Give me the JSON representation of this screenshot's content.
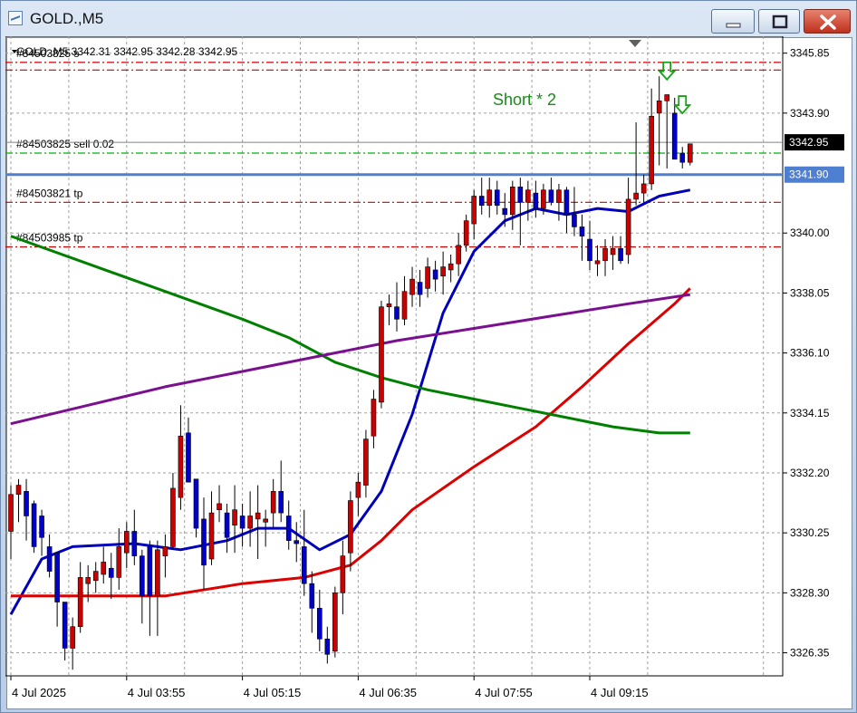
{
  "window": {
    "title": "GOLD.,M5",
    "minimize_icon": "minimize-icon",
    "maximize_icon": "maximize-icon",
    "close_icon": "close-icon"
  },
  "header_info": {
    "ohlc_text": "GOLD.,M5  3342.31 3342.95 3342.28 3342.95",
    "overlay_text": "#84503825 s"
  },
  "annotation": {
    "text": "Short * 2",
    "color": "#1a8a1a"
  },
  "price_axis": {
    "labels": [
      "3345.85",
      "3343.90",
      "3342.95",
      "3341.90",
      "3340.00",
      "3338.05",
      "3336.10",
      "3334.15",
      "3332.20",
      "3330.25",
      "3328.30",
      "3326.35"
    ]
  },
  "time_axis": {
    "labels": [
      "4 Jul 2025",
      "4 Jul 03:55",
      "4 Jul 05:15",
      "4 Jul 06:35",
      "4 Jul 07:55",
      "4 Jul 09:15"
    ]
  },
  "order_lines": [
    {
      "label": "#84503825 sell 0.02",
      "price": 3342.6,
      "color": "#00b000",
      "style": "dashdot"
    },
    {
      "label": "#84503821 tp",
      "price": 3341.0,
      "color": "#cc0000",
      "style": "dashdot"
    },
    {
      "label": "#84503985 tp",
      "price": 3339.55,
      "color": "#cc0000",
      "style": "dashdot"
    },
    {
      "label": "",
      "price": 3345.55,
      "color": "#cc0000",
      "style": "dashdot"
    },
    {
      "label": "",
      "price": 3345.3,
      "color": "#cc0000",
      "style": "dashdot"
    }
  ],
  "bid_line": {
    "price": 3342.95,
    "label": "3342.95"
  },
  "ask_line": {
    "price": 3341.9,
    "label": "3341.90",
    "color": "#4f7fd0"
  },
  "colors": {
    "bull": "#0000cc",
    "bear": "#cc0000",
    "ma_fast": "#0000bb",
    "ma_mid": "#dd0000",
    "ma_slow": "#008000",
    "ma_long": "#7a1090"
  },
  "chart_data": {
    "type": "candlestick",
    "symbol": "GOLD.",
    "timeframe": "M5",
    "ylim": [
      3325.6,
      3346.4
    ],
    "x_tick_labels": [
      "4 Jul 2025",
      "4 Jul 03:55",
      "4 Jul 05:15",
      "4 Jul 06:35",
      "4 Jul 07:55",
      "4 Jul 09:15"
    ],
    "candles": [
      [
        3330.3,
        3331.8,
        3329.4,
        3331.5
      ],
      [
        3331.5,
        3332.0,
        3330.6,
        3331.8
      ],
      [
        3331.6,
        3332.0,
        3330.0,
        3330.8
      ],
      [
        3331.2,
        3331.3,
        3329.6,
        3329.8
      ],
      [
        3330.8,
        3331.0,
        3329.5,
        3330.1
      ],
      [
        3329.8,
        3330.2,
        3328.8,
        3329.0
      ],
      [
        3329.6,
        3329.6,
        3327.2,
        3328.0
      ],
      [
        3328.0,
        3328.0,
        3326.1,
        3326.5
      ],
      [
        3326.5,
        3327.5,
        3325.8,
        3327.2
      ],
      [
        3327.2,
        3329.3,
        3327.0,
        3328.8
      ],
      [
        3328.6,
        3329.2,
        3328.0,
        3328.8
      ],
      [
        3328.7,
        3329.3,
        3328.3,
        3329.0
      ],
      [
        3328.9,
        3329.8,
        3328.6,
        3329.3
      ],
      [
        3329.1,
        3329.6,
        3328.1,
        3328.8
      ],
      [
        3328.8,
        3330.4,
        3328.4,
        3329.8
      ],
      [
        3329.6,
        3330.6,
        3329.1,
        3330.3
      ],
      [
        3330.3,
        3331.0,
        3329.2,
        3329.5
      ],
      [
        3329.5,
        3329.7,
        3327.3,
        3328.2
      ],
      [
        3329.8,
        3330.0,
        3326.9,
        3328.2
      ],
      [
        3328.2,
        3330.0,
        3326.9,
        3329.7
      ],
      [
        3329.5,
        3330.2,
        3328.8,
        3329.8
      ],
      [
        3329.8,
        3332.2,
        3329.7,
        3331.7
      ],
      [
        3331.4,
        3334.4,
        3331.0,
        3333.4
      ],
      [
        3333.5,
        3334.0,
        3332.0,
        3331.9
      ],
      [
        3332.0,
        3332.0,
        3330.1,
        3330.4
      ],
      [
        3330.7,
        3331.4,
        3328.4,
        3329.2
      ],
      [
        3329.4,
        3331.6,
        3329.2,
        3330.9
      ],
      [
        3331.0,
        3331.8,
        3330.6,
        3331.2
      ],
      [
        3330.9,
        3331.2,
        3329.6,
        3330.1
      ],
      [
        3330.5,
        3331.8,
        3329.6,
        3331.0
      ],
      [
        3330.8,
        3331.2,
        3329.8,
        3330.4
      ],
      [
        3330.4,
        3331.6,
        3329.8,
        3330.8
      ],
      [
        3330.7,
        3331.8,
        3329.4,
        3330.9
      ],
      [
        3330.6,
        3331.0,
        3329.8,
        3330.7
      ],
      [
        3330.9,
        3332.0,
        3330.4,
        3331.6
      ],
      [
        3331.6,
        3332.6,
        3330.6,
        3330.9
      ],
      [
        3330.8,
        3331.3,
        3329.7,
        3330.0
      ],
      [
        3330.0,
        3330.6,
        3329.3,
        3329.9
      ],
      [
        3329.8,
        3331.0,
        3328.2,
        3328.6
      ],
      [
        3328.6,
        3329.0,
        3327.0,
        3327.8
      ],
      [
        3327.8,
        3328.4,
        3326.4,
        3326.8
      ],
      [
        3326.8,
        3327.2,
        3326.0,
        3326.3
      ],
      [
        3326.4,
        3328.5,
        3326.2,
        3328.3
      ],
      [
        3328.3,
        3330.0,
        3327.6,
        3329.5
      ],
      [
        3329.6,
        3331.6,
        3329.0,
        3331.3
      ],
      [
        3331.4,
        3332.2,
        3330.8,
        3331.9
      ],
      [
        3331.8,
        3333.6,
        3331.4,
        3333.3
      ],
      [
        3333.4,
        3334.9,
        3333.0,
        3334.6
      ],
      [
        3334.5,
        3337.8,
        3334.3,
        3337.6
      ],
      [
        3337.6,
        3338.0,
        3337.0,
        3337.7
      ],
      [
        3337.6,
        3338.4,
        3336.8,
        3337.2
      ],
      [
        3337.2,
        3338.6,
        3337.0,
        3338.1
      ],
      [
        3338.0,
        3338.9,
        3337.6,
        3338.5
      ],
      [
        3338.4,
        3338.8,
        3337.6,
        3338.0
      ],
      [
        3338.2,
        3339.2,
        3337.9,
        3338.9
      ],
      [
        3338.8,
        3339.1,
        3338.1,
        3338.5
      ],
      [
        3338.6,
        3339.4,
        3338.0,
        3338.9
      ],
      [
        3338.8,
        3339.3,
        3338.4,
        3339.0
      ],
      [
        3339.0,
        3340.0,
        3338.6,
        3339.6
      ],
      [
        3339.6,
        3340.6,
        3339.4,
        3340.4
      ],
      [
        3340.3,
        3341.4,
        3339.8,
        3341.2
      ],
      [
        3341.2,
        3341.8,
        3340.6,
        3340.9
      ],
      [
        3340.9,
        3341.8,
        3340.5,
        3341.4
      ],
      [
        3341.4,
        3341.7,
        3340.6,
        3340.9
      ],
      [
        3340.8,
        3341.3,
        3340.2,
        3340.6
      ],
      [
        3340.6,
        3341.7,
        3340.1,
        3341.5
      ],
      [
        3341.5,
        3341.8,
        3339.6,
        3341.0
      ],
      [
        3341.0,
        3341.7,
        3340.4,
        3341.4
      ],
      [
        3341.3,
        3341.7,
        3340.5,
        3340.8
      ],
      [
        3340.8,
        3341.6,
        3340.6,
        3341.4
      ],
      [
        3341.4,
        3341.8,
        3340.9,
        3341.0
      ],
      [
        3341.0,
        3341.6,
        3340.4,
        3341.4
      ],
      [
        3341.4,
        3341.5,
        3340.0,
        3340.6
      ],
      [
        3340.6,
        3341.5,
        3339.9,
        3340.2
      ],
      [
        3340.2,
        3340.6,
        3339.1,
        3339.9
      ],
      [
        3339.8,
        3340.4,
        3338.8,
        3339.1
      ],
      [
        3339.0,
        3339.6,
        3338.6,
        3339.1
      ],
      [
        3339.1,
        3339.8,
        3338.6,
        3339.5
      ],
      [
        3339.3,
        3339.9,
        3338.8,
        3339.5
      ],
      [
        3339.5,
        3339.9,
        3339.0,
        3339.1
      ],
      [
        3339.3,
        3341.8,
        3339.0,
        3341.1
      ],
      [
        3341.1,
        3343.6,
        3340.9,
        3341.3
      ],
      [
        3341.3,
        3341.9,
        3341.0,
        3341.6
      ],
      [
        3341.6,
        3344.7,
        3341.4,
        3343.8
      ],
      [
        3343.9,
        3345.1,
        3342.2,
        3344.3
      ],
      [
        3344.3,
        3344.5,
        3342.1,
        3344.5
      ],
      [
        3343.9,
        3344.4,
        3342.4,
        3342.4
      ],
      [
        3342.6,
        3342.8,
        3342.1,
        3342.3
      ],
      [
        3342.3,
        3342.9,
        3342.2,
        3342.9
      ]
    ],
    "series": [
      {
        "name": "",
        "color": "#0000bb",
        "points": [
          [
            0,
            3327.6
          ],
          [
            4,
            3329.4
          ],
          [
            8,
            3329.8
          ],
          [
            16,
            3329.9
          ],
          [
            22,
            3329.7
          ],
          [
            28,
            3330.0
          ],
          [
            32,
            3330.4
          ],
          [
            36,
            3330.4
          ],
          [
            40,
            3329.7
          ],
          [
            44,
            3330.2
          ],
          [
            48,
            3331.6
          ],
          [
            52,
            3334.1
          ],
          [
            56,
            3337.4
          ],
          [
            60,
            3339.4
          ],
          [
            64,
            3340.4
          ],
          [
            68,
            3340.8
          ],
          [
            72,
            3340.6
          ],
          [
            76,
            3340.8
          ],
          [
            80,
            3340.7
          ],
          [
            84,
            3341.2
          ],
          [
            88,
            3341.4
          ]
        ]
      },
      {
        "name": "",
        "color": "#dd0000",
        "points": [
          [
            0,
            3328.2
          ],
          [
            10,
            3328.2
          ],
          [
            20,
            3328.2
          ],
          [
            30,
            3328.6
          ],
          [
            38,
            3328.8
          ],
          [
            44,
            3329.2
          ],
          [
            48,
            3330.0
          ],
          [
            52,
            3331.0
          ],
          [
            60,
            3332.4
          ],
          [
            68,
            3333.7
          ],
          [
            74,
            3335.0
          ],
          [
            80,
            3336.4
          ],
          [
            86,
            3337.7
          ],
          [
            88,
            3338.2
          ]
        ]
      },
      {
        "name": "",
        "color": "#008000",
        "points": [
          [
            0,
            3339.9
          ],
          [
            10,
            3339.0
          ],
          [
            20,
            3338.1
          ],
          [
            30,
            3337.2
          ],
          [
            36,
            3336.6
          ],
          [
            42,
            3335.8
          ],
          [
            48,
            3335.3
          ],
          [
            54,
            3334.9
          ],
          [
            60,
            3334.6
          ],
          [
            66,
            3334.3
          ],
          [
            72,
            3334.0
          ],
          [
            78,
            3333.7
          ],
          [
            84,
            3333.5
          ],
          [
            88,
            3333.5
          ]
        ]
      },
      {
        "name": "",
        "color": "#7a1090",
        "points": [
          [
            0,
            3333.8
          ],
          [
            10,
            3334.4
          ],
          [
            20,
            3335.0
          ],
          [
            30,
            3335.5
          ],
          [
            40,
            3336.0
          ],
          [
            50,
            3336.5
          ],
          [
            60,
            3336.9
          ],
          [
            70,
            3337.3
          ],
          [
            80,
            3337.7
          ],
          [
            88,
            3338.0
          ]
        ]
      }
    ],
    "signals": [
      {
        "index": 85,
        "price": 3345.2,
        "type": "sell"
      },
      {
        "index": 87,
        "price": 3344.1,
        "type": "sell"
      }
    ],
    "grid": true
  }
}
